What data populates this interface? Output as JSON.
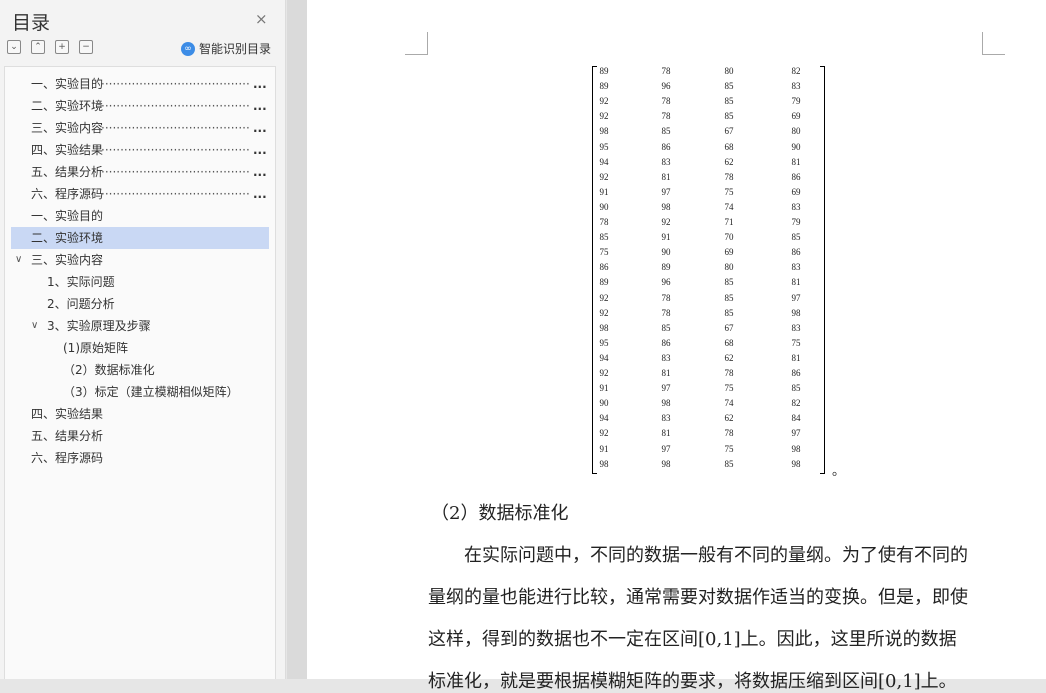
{
  "sidebar": {
    "title": "目录",
    "close_icon": "×",
    "tools": [
      {
        "name": "collapse-all",
        "glyph": "⌄"
      },
      {
        "name": "expand-all",
        "glyph": "⌃"
      },
      {
        "name": "add-level",
        "glyph": "+"
      },
      {
        "name": "remove-level",
        "glyph": "−"
      }
    ],
    "smart_label": "智能识别目录",
    "toc": [
      {
        "label": "一、实验目的",
        "dots": true,
        "indent": 0
      },
      {
        "label": "二、实验环境",
        "dots": true,
        "indent": 0
      },
      {
        "label": "三、实验内容",
        "dots": true,
        "indent": 0
      },
      {
        "label": "四、实验结果",
        "dots": true,
        "indent": 0
      },
      {
        "label": "五、结果分析",
        "dots": true,
        "indent": 0
      },
      {
        "label": "六、程序源码",
        "dots": true,
        "indent": 0
      },
      {
        "label": "一、实验目的",
        "indent": 0
      },
      {
        "label": "二、实验环境",
        "indent": 0,
        "active": true
      },
      {
        "label": "三、实验内容",
        "indent": 0,
        "chevron": true
      },
      {
        "label": "1、实际问题",
        "indent": 1
      },
      {
        "label": "2、问题分析",
        "indent": 1
      },
      {
        "label": "3、实验原理及步骤",
        "indent": 1,
        "chevron": true
      },
      {
        "label": "(1)原始矩阵",
        "indent": 2
      },
      {
        "label": "（2）数据标准化",
        "indent": 2
      },
      {
        "label": "（3）标定（建立模糊相似矩阵）",
        "indent": 2
      },
      {
        "label": "四、实验结果",
        "indent": 0
      },
      {
        "label": "五、结果分析",
        "indent": 0
      },
      {
        "label": "六、程序源码",
        "indent": 0
      }
    ],
    "dots_text": "·········································",
    "ellipsis": "..."
  },
  "document": {
    "matrix_rows": [
      [
        "89",
        "78",
        "80",
        "82"
      ],
      [
        "89",
        "96",
        "85",
        "83"
      ],
      [
        "92",
        "78",
        "85",
        "79"
      ],
      [
        "92",
        "78",
        "85",
        "69"
      ],
      [
        "98",
        "85",
        "67",
        "80"
      ],
      [
        "95",
        "86",
        "68",
        "90"
      ],
      [
        "94",
        "83",
        "62",
        "81"
      ],
      [
        "92",
        "81",
        "78",
        "86"
      ],
      [
        "91",
        "97",
        "75",
        "69"
      ],
      [
        "90",
        "98",
        "74",
        "83"
      ],
      [
        "78",
        "92",
        "71",
        "79"
      ],
      [
        "85",
        "91",
        "70",
        "85"
      ],
      [
        "75",
        "90",
        "69",
        "86"
      ],
      [
        "86",
        "89",
        "80",
        "83"
      ],
      [
        "89",
        "96",
        "85",
        "81"
      ],
      [
        "92",
        "78",
        "85",
        "97"
      ],
      [
        "92",
        "78",
        "85",
        "98"
      ],
      [
        "98",
        "85",
        "67",
        "83"
      ],
      [
        "95",
        "86",
        "68",
        "75"
      ],
      [
        "94",
        "83",
        "62",
        "81"
      ],
      [
        "92",
        "81",
        "78",
        "86"
      ],
      [
        "91",
        "97",
        "75",
        "85"
      ],
      [
        "90",
        "98",
        "74",
        "82"
      ],
      [
        "94",
        "83",
        "62",
        "84"
      ],
      [
        "92",
        "81",
        "78",
        "97"
      ],
      [
        "91",
        "97",
        "75",
        "98"
      ],
      [
        "98",
        "98",
        "85",
        "98"
      ]
    ],
    "matrix_end": "。",
    "heading": "（2）数据标准化",
    "paragraph_lines": [
      "　　在实际问题中，不同的数据一般有不同的量纲。为了使有不同的",
      "量纲的量也能进行比较，通常需要对数据作适当的变换。但是，即使",
      "这样，得到的数据也不一定在区间[0,1]上。因此，这里所说的数据",
      "标准化，就是要根据模糊矩阵的要求，将数据压缩到区间[0,1]上。"
    ]
  }
}
